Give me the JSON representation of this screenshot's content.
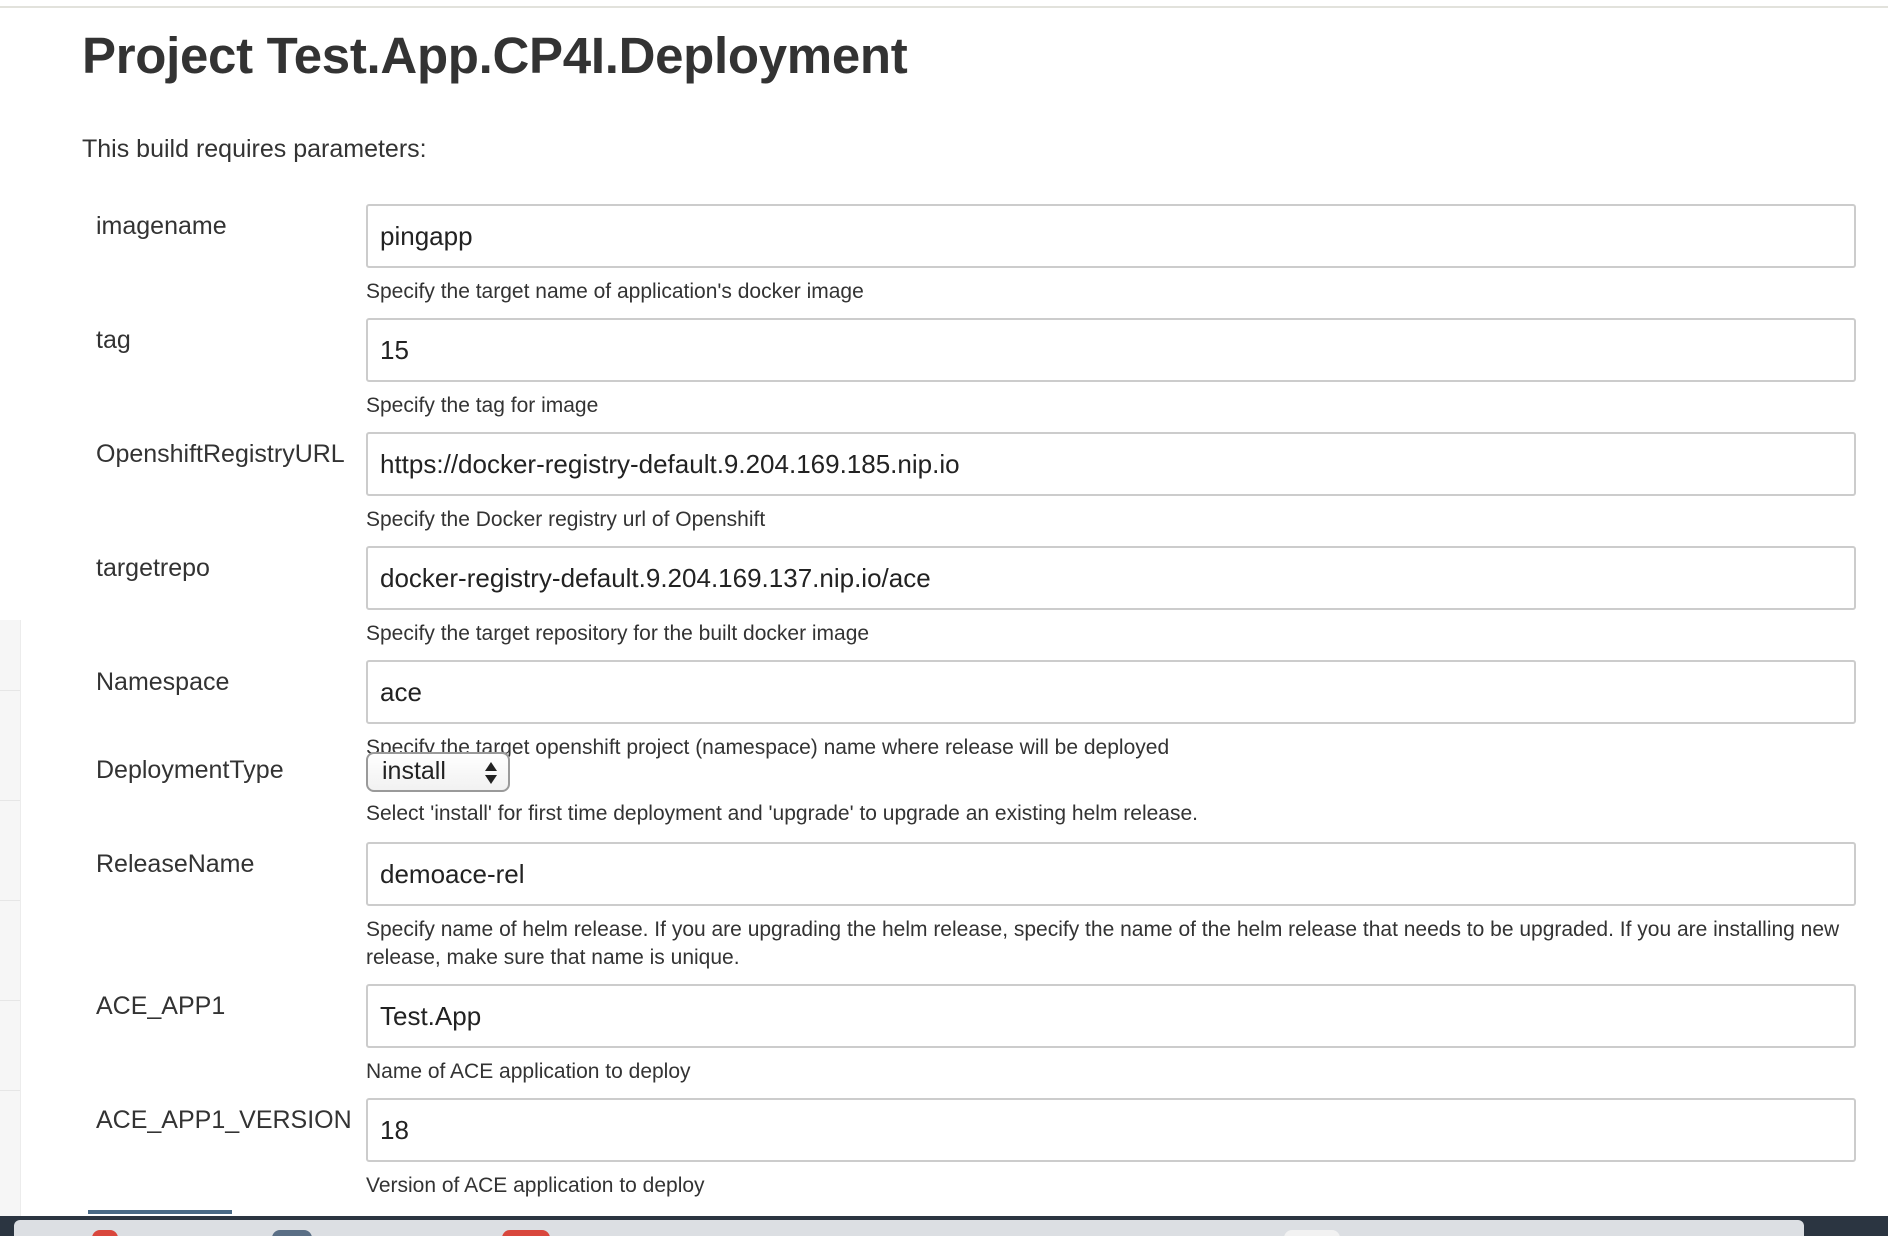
{
  "page": {
    "title": "Project Test.App.CP4I.Deployment",
    "subtitle": "This build requires parameters:"
  },
  "params": [
    {
      "label": "imagename",
      "value": "pingapp",
      "description": "Specify the target name of application's docker image"
    },
    {
      "label": "tag",
      "value": "15",
      "description": "Specify the tag for image"
    },
    {
      "label": "OpenshiftRegistryURL",
      "value": "https://docker-registry-default.9.204.169.185.nip.io",
      "description": "Specify the Docker registry url of Openshift"
    },
    {
      "label": "targetrepo",
      "value": "docker-registry-default.9.204.169.137.nip.io/ace",
      "description": "Specify the target repository for the built docker image"
    },
    {
      "label": "Namespace",
      "value": "ace",
      "description": "Specify the target openshift project (namespace) name where release will be deployed"
    },
    {
      "label": "DeploymentType",
      "value": "install",
      "description": "Select 'install' for first time deployment and 'upgrade' to upgrade an existing helm release."
    },
    {
      "label": "ReleaseName",
      "value": "demoace-rel",
      "description": "Specify name of helm release. If you are upgrading the helm release, specify the name of the helm release that needs to be upgraded. If you are installing new release, make sure that name is unique."
    },
    {
      "label": "ACE_APP1",
      "value": "Test.App",
      "description": "Name of ACE application to deploy"
    },
    {
      "label": "ACE_APP1_VERSION",
      "value": "18",
      "description": "Version of ACE application to deploy"
    }
  ],
  "icons": {
    "select_arrows": "up-down-arrows-icon"
  },
  "colors": {
    "text": "#333333",
    "input_border": "#cccccc",
    "taskbar": "#2b3541"
  }
}
